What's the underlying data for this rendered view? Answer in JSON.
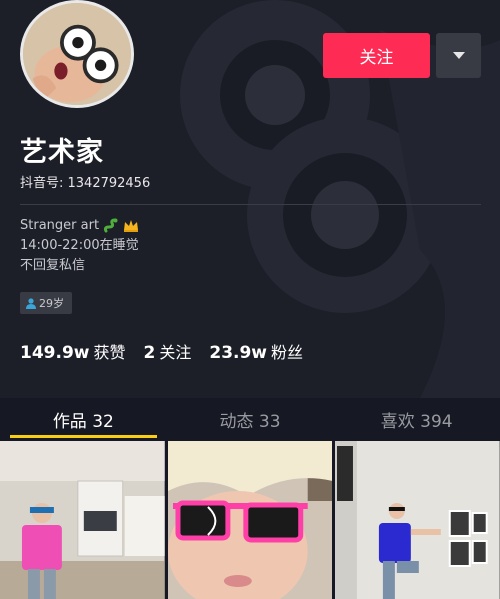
{
  "profile": {
    "nickname": "艺术家",
    "douyin_id": "抖音号: 1342792456",
    "bio_line1": "Stranger art",
    "bio_line1_emojis": [
      "snake",
      "crown"
    ],
    "bio_line2": "14:00-22:00在睡觉",
    "bio_line3": "不回复私信",
    "age_tag": "29岁"
  },
  "actions": {
    "follow_label": "关注",
    "more_icon": "triangle-down-icon"
  },
  "stats": {
    "likes_num": "149.9w",
    "likes_label": "获赞",
    "following_num": "2",
    "following_label": "关注",
    "fans_num": "23.9w",
    "fans_label": "粉丝"
  },
  "tabs": [
    {
      "label": "作品 32",
      "active": true
    },
    {
      "label": "动态 33",
      "active": false
    },
    {
      "label": "喜欢 394",
      "active": false
    }
  ],
  "colors": {
    "accent": "#fe2c55",
    "tab_indicator": "#face15",
    "background": "#161823"
  }
}
